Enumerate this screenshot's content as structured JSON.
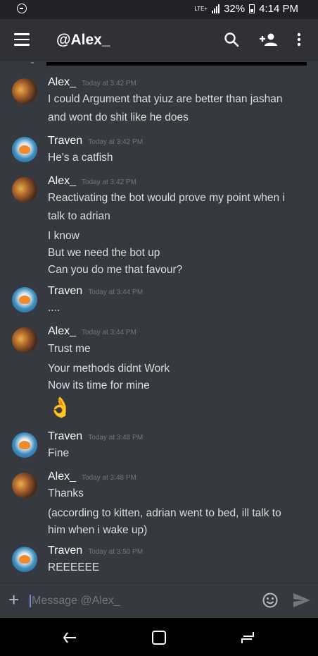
{
  "status_bar": {
    "network": "LTE+",
    "battery": "32%",
    "time": "4:14 PM"
  },
  "app_bar": {
    "title": "@Alex_",
    "icons": [
      "menu-icon",
      "search-icon",
      "add-friend-icon",
      "more-vertical-icon"
    ]
  },
  "messages": [
    {
      "author": "Alex_",
      "avatar": "alex",
      "timestamp": "Today at 3:42 PM",
      "lines": [
        "I could Argument that yiuz are better than jashan",
        "and wont do shit like he does"
      ]
    },
    {
      "author": "Traven",
      "avatar": "traven",
      "timestamp": "Today at 3:42 PM",
      "lines": [
        "He's a catfish"
      ]
    },
    {
      "author": "Alex_",
      "avatar": "alex",
      "timestamp": "Today at 3:42 PM",
      "lines": [
        "Reactivating the bot would prove my point when i",
        "talk to adrian",
        "I know",
        "But we need the bot up",
        "Can you do me that favour?"
      ]
    },
    {
      "author": "Traven",
      "avatar": "traven",
      "timestamp": "Today at 3:44 PM",
      "lines": [
        "...."
      ]
    },
    {
      "author": "Alex_",
      "avatar": "alex",
      "timestamp": "Today at 3:44 PM",
      "lines": [
        "Trust me",
        "Your methods didnt Work",
        "Now its time for mine",
        "👌"
      ]
    },
    {
      "author": "Traven",
      "avatar": "traven",
      "timestamp": "Today at 3:48 PM",
      "lines": [
        "Fine"
      ]
    },
    {
      "author": "Alex_",
      "avatar": "alex",
      "timestamp": "Today at 3:48 PM",
      "lines": [
        "Thanks",
        "(according to kitten, adrian went to bed, ill talk to",
        "him when i wake up)"
      ]
    },
    {
      "author": "Traven",
      "avatar": "traven",
      "timestamp": "Today at 3:50 PM",
      "lines": [
        "REEEEEE"
      ]
    }
  ],
  "composer": {
    "placeholder": "Message @Alex_"
  },
  "colors": {
    "background": "#36393f",
    "appbar": "#2f3136",
    "accent": "#7289da",
    "timestamp": "#72767d"
  }
}
